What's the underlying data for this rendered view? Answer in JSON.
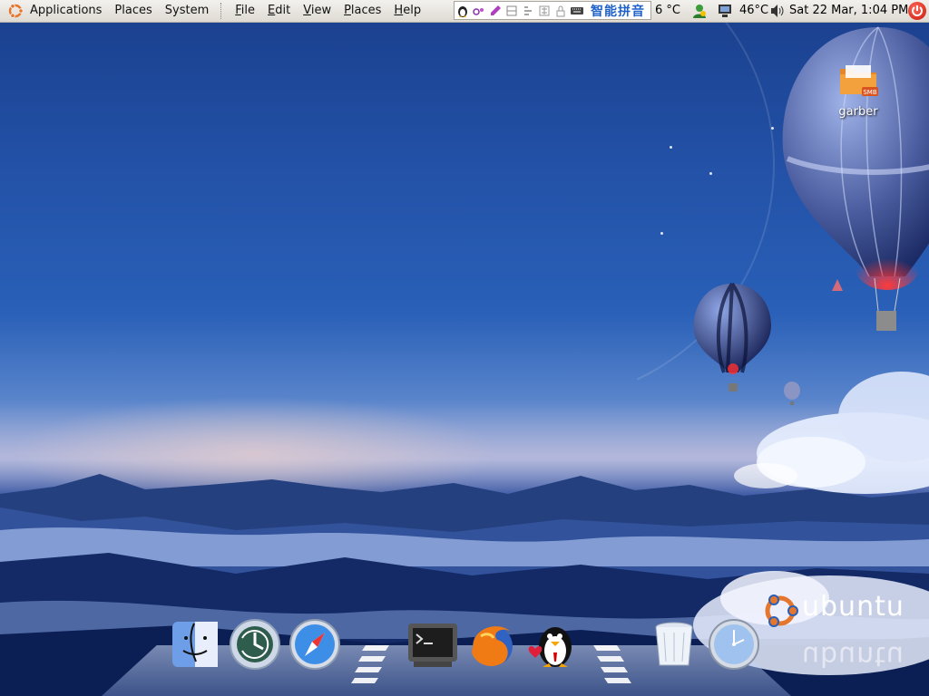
{
  "panel": {
    "menus": [
      {
        "label": "Applications"
      },
      {
        "label": "Places"
      },
      {
        "label": "System"
      }
    ],
    "app_menus": [
      {
        "label": "File",
        "mnemonic": "F",
        "rest": "ile"
      },
      {
        "label": "Edit",
        "mnemonic": "E",
        "rest": "dit"
      },
      {
        "label": "View",
        "mnemonic": "V",
        "rest": "iew"
      },
      {
        "label": "Places",
        "mnemonic": "P",
        "rest": "laces"
      },
      {
        "label": "Help",
        "mnemonic": "H",
        "rest": "elp"
      }
    ],
    "ime": {
      "name": "智能拼音",
      "icons": [
        "tux-icon",
        "input-mode-icon",
        "pen-icon",
        "full-width-icon",
        "punctuation-icon",
        "traditional-icon",
        "lock-icon",
        "keyboard-icon"
      ]
    },
    "temp_left": "6 °C",
    "cpu_temp": "46°C",
    "clock": "Sat 22 Mar,  1:04 PM"
  },
  "desktop": {
    "icons": [
      {
        "label": "garber",
        "icon": "smb-folder-icon",
        "badge": "SMB"
      }
    ]
  },
  "dock": {
    "items": [
      {
        "name": "finder-icon"
      },
      {
        "name": "time-machine-icon"
      },
      {
        "name": "safari-icon"
      },
      {
        "name": "terminal-icon"
      },
      {
        "name": "firefox-icon"
      },
      {
        "name": "qq-penguin-icon"
      },
      {
        "name": "trash-icon"
      },
      {
        "name": "clock-icon"
      }
    ]
  },
  "branding": {
    "wordmark": "ubuntu"
  },
  "colors": {
    "panel_bg": "#e9e6e1",
    "ime_text": "#1f62c9",
    "ubuntu_orange": "#e5762e",
    "shutdown_red": "#d2231a"
  }
}
